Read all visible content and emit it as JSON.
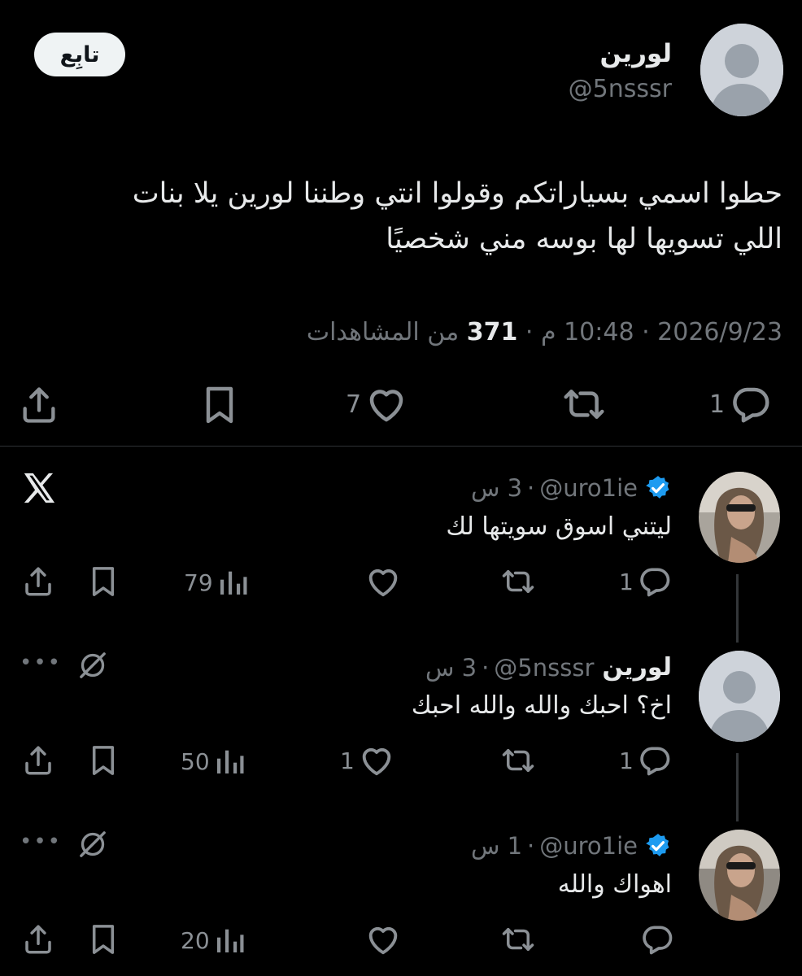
{
  "main_tweet": {
    "author_name": "لورين",
    "author_handle": "@5nsssr",
    "follow_label": "تابِع",
    "text_line1": "حطوا اسمي بسياراتكم وقولوا انتي وطننا لورين يلا بنات",
    "text_line2": "اللي تسويها لها بوسه مني شخصيًا",
    "date": "2026/9/23",
    "time": "10:48 م",
    "views_count": "371",
    "views_label": "من المشاهدات",
    "replies": "1",
    "likes": "7"
  },
  "replies": [
    {
      "name": "",
      "handle": "@uro1ie",
      "verified": true,
      "age": "3 س",
      "text": "ليتني اسوق سويتها لك",
      "replies": "1",
      "likes": "",
      "views": "79",
      "corner_icon": "x-logo-icon"
    },
    {
      "name": "لورين",
      "handle": "@5nsssr",
      "verified": false,
      "age": "3 س",
      "text": "اخ؟ احبك والله والله احبك",
      "replies": "1",
      "likes": "1",
      "views": "50",
      "corner_icon": "mute-icon"
    },
    {
      "name": "",
      "handle": "@uro1ie",
      "verified": true,
      "age": "1 س",
      "text": "اهواك والله",
      "replies": "",
      "likes": "",
      "views": "20",
      "corner_icon": "mute-icon"
    }
  ],
  "colors": {
    "background": "#000000",
    "text": "#e7e9ea",
    "muted": "#71767b",
    "verified": "#1d9bf0",
    "follow_button": "#eff3f4"
  },
  "dots": "•••"
}
